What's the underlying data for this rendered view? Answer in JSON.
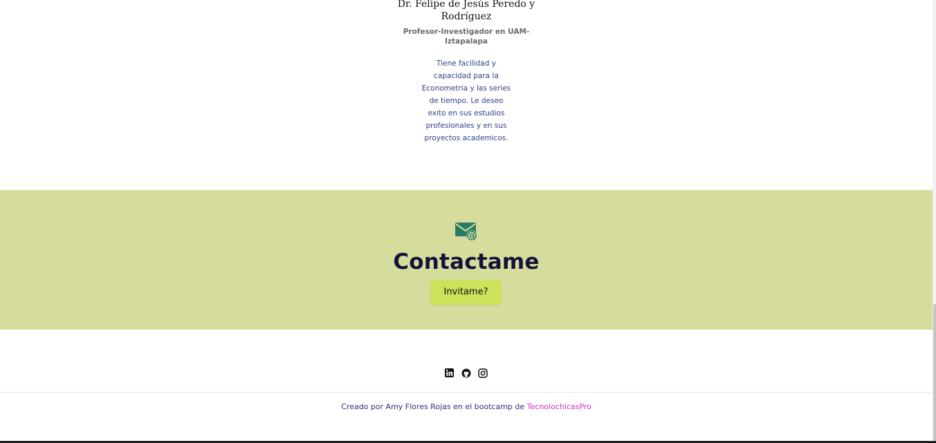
{
  "testimonial": {
    "name": "Dr. Felipe de Jesús Peredo y Rodríguez",
    "role": "Profesor-Investigador en UAM-Iztapalapa",
    "quote": "Tiene facilidad y capacidad para la Econometria y las series de tiempo. Le deseo exito en sus estudios profesionales y en sus proyectos academicos."
  },
  "contact": {
    "icon": "envelope-at-icon",
    "title": "Contactame",
    "button_label": "Invitame?",
    "background_color": "#d6dc9c",
    "button_color": "#cde25a"
  },
  "footer": {
    "social": [
      {
        "icon": "linkedin-icon"
      },
      {
        "icon": "github-icon"
      },
      {
        "icon": "instagram-icon"
      }
    ],
    "credits_text": "Creado por Amy Flores Rojas en el bootcamp de ",
    "credits_link": "TecnolochicasPro",
    "link_color": "#cc2bc6"
  }
}
